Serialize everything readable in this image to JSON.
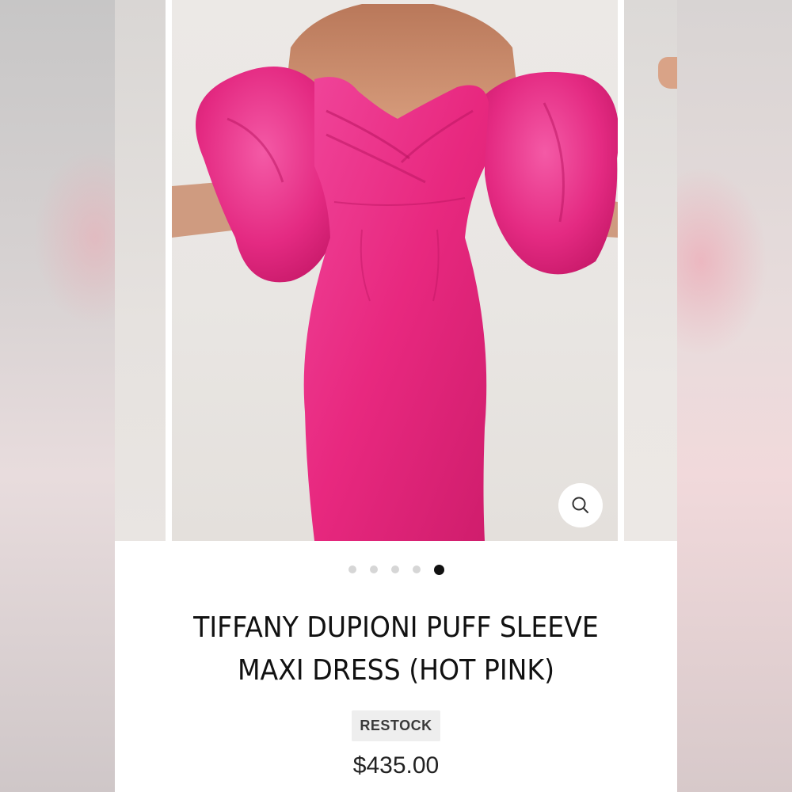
{
  "product": {
    "title_line1": "TIFFANY DUPIONI PUFF SLEEVE",
    "title_line2": "MAXI DRESS (HOT PINK)",
    "badge": "RESTOCK",
    "price": "$435.00",
    "color": "#e8287f"
  },
  "gallery": {
    "image_count": 5,
    "active_index": 4,
    "zoom_icon": "magnifier-icon"
  },
  "colors": {
    "dress_pink": "#e8287f",
    "dot_inactive": "#d6d6d6",
    "dot_active": "#111111",
    "badge_bg": "#eeeeee"
  }
}
